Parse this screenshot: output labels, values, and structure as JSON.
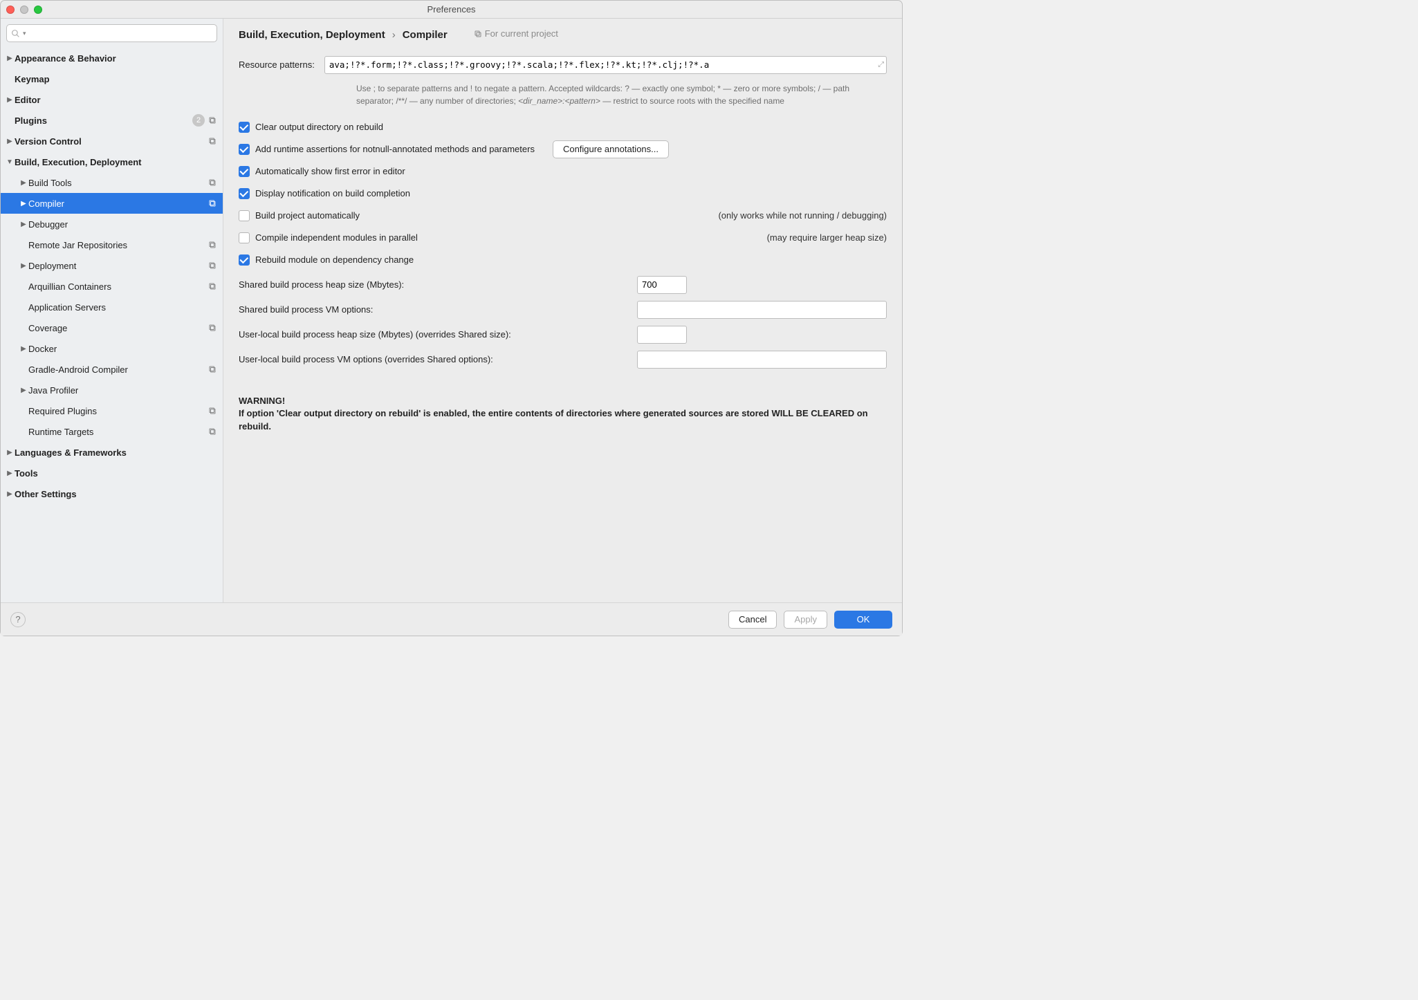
{
  "window": {
    "title": "Preferences"
  },
  "search": {
    "placeholder": ""
  },
  "sidebar": {
    "items": [
      {
        "label": "Appearance & Behavior",
        "bold": true,
        "chev": "right",
        "badge": "",
        "proj": false
      },
      {
        "label": "Keymap",
        "bold": true,
        "chev": "",
        "badge": "",
        "proj": false
      },
      {
        "label": "Editor",
        "bold": true,
        "chev": "right",
        "badge": "",
        "proj": false
      },
      {
        "label": "Plugins",
        "bold": true,
        "chev": "",
        "badge": "2",
        "proj": true
      },
      {
        "label": "Version Control",
        "bold": true,
        "chev": "right",
        "badge": "",
        "proj": true
      },
      {
        "label": "Build, Execution, Deployment",
        "bold": true,
        "chev": "down",
        "badge": "",
        "proj": false
      },
      {
        "label": "Build Tools",
        "bold": false,
        "chev": "right",
        "badge": "",
        "proj": true,
        "indent": 1
      },
      {
        "label": "Compiler",
        "bold": false,
        "chev": "right",
        "badge": "",
        "proj": true,
        "indent": 1,
        "selected": true
      },
      {
        "label": "Debugger",
        "bold": false,
        "chev": "right",
        "badge": "",
        "proj": false,
        "indent": 1
      },
      {
        "label": "Remote Jar Repositories",
        "bold": false,
        "chev": "",
        "badge": "",
        "proj": true,
        "indent": 1
      },
      {
        "label": "Deployment",
        "bold": false,
        "chev": "right",
        "badge": "",
        "proj": true,
        "indent": 1
      },
      {
        "label": "Arquillian Containers",
        "bold": false,
        "chev": "",
        "badge": "",
        "proj": true,
        "indent": 1
      },
      {
        "label": "Application Servers",
        "bold": false,
        "chev": "",
        "badge": "",
        "proj": false,
        "indent": 1
      },
      {
        "label": "Coverage",
        "bold": false,
        "chev": "",
        "badge": "",
        "proj": true,
        "indent": 1
      },
      {
        "label": "Docker",
        "bold": false,
        "chev": "right",
        "badge": "",
        "proj": false,
        "indent": 1
      },
      {
        "label": "Gradle-Android Compiler",
        "bold": false,
        "chev": "",
        "badge": "",
        "proj": true,
        "indent": 1
      },
      {
        "label": "Java Profiler",
        "bold": false,
        "chev": "right",
        "badge": "",
        "proj": false,
        "indent": 1
      },
      {
        "label": "Required Plugins",
        "bold": false,
        "chev": "",
        "badge": "",
        "proj": true,
        "indent": 1
      },
      {
        "label": "Runtime Targets",
        "bold": false,
        "chev": "",
        "badge": "",
        "proj": true,
        "indent": 1
      },
      {
        "label": "Languages & Frameworks",
        "bold": true,
        "chev": "right",
        "badge": "",
        "proj": false
      },
      {
        "label": "Tools",
        "bold": true,
        "chev": "right",
        "badge": "",
        "proj": false
      },
      {
        "label": "Other Settings",
        "bold": true,
        "chev": "right",
        "badge": "",
        "proj": false
      }
    ]
  },
  "header": {
    "path_parent": "Build, Execution, Deployment",
    "path_sep": "›",
    "path_leaf": "Compiler",
    "scope_label": "For current project"
  },
  "content": {
    "resource_patterns_label": "Resource patterns:",
    "resource_patterns_value": "ava;!?*.form;!?*.class;!?*.groovy;!?*.scala;!?*.flex;!?*.kt;!?*.clj;!?*.a",
    "resource_patterns_hint_1": "Use ; to separate patterns and ! to negate a pattern. Accepted wildcards: ? — exactly one symbol; * — zero or more symbols; / — path separator; /**/ — any number of directories; ",
    "resource_patterns_hint_2": "<dir_name>:<pattern>",
    "resource_patterns_hint_3": " — restrict to source roots with the specified name",
    "cb_clear_output": "Clear output directory on rebuild",
    "cb_notnull": "Add runtime assertions for notnull-annotated methods and parameters",
    "btn_configure_annotations": "Configure annotations...",
    "cb_first_error": "Automatically show first error in editor",
    "cb_notify_build": "Display notification on build completion",
    "cb_auto_build": "Build project automatically",
    "cb_auto_build_aside": "(only works while not running / debugging)",
    "cb_parallel": "Compile independent modules in parallel",
    "cb_parallel_aside": "(may require larger heap size)",
    "cb_rebuild_dep": "Rebuild module on dependency change",
    "heap_shared_label": "Shared build process heap size (Mbytes):",
    "heap_shared_value": "700",
    "vm_shared_label": "Shared build process VM options:",
    "vm_shared_value": "",
    "heap_local_label": "User-local build process heap size (Mbytes) (overrides Shared size):",
    "heap_local_value": "",
    "vm_local_label": "User-local build process VM options (overrides Shared options):",
    "vm_local_value": "",
    "warning_title": "WARNING!",
    "warning_body": "If option 'Clear output directory on rebuild' is enabled, the entire contents of directories where generated sources are stored WILL BE CLEARED on rebuild."
  },
  "footer": {
    "cancel": "Cancel",
    "apply": "Apply",
    "ok": "OK"
  }
}
